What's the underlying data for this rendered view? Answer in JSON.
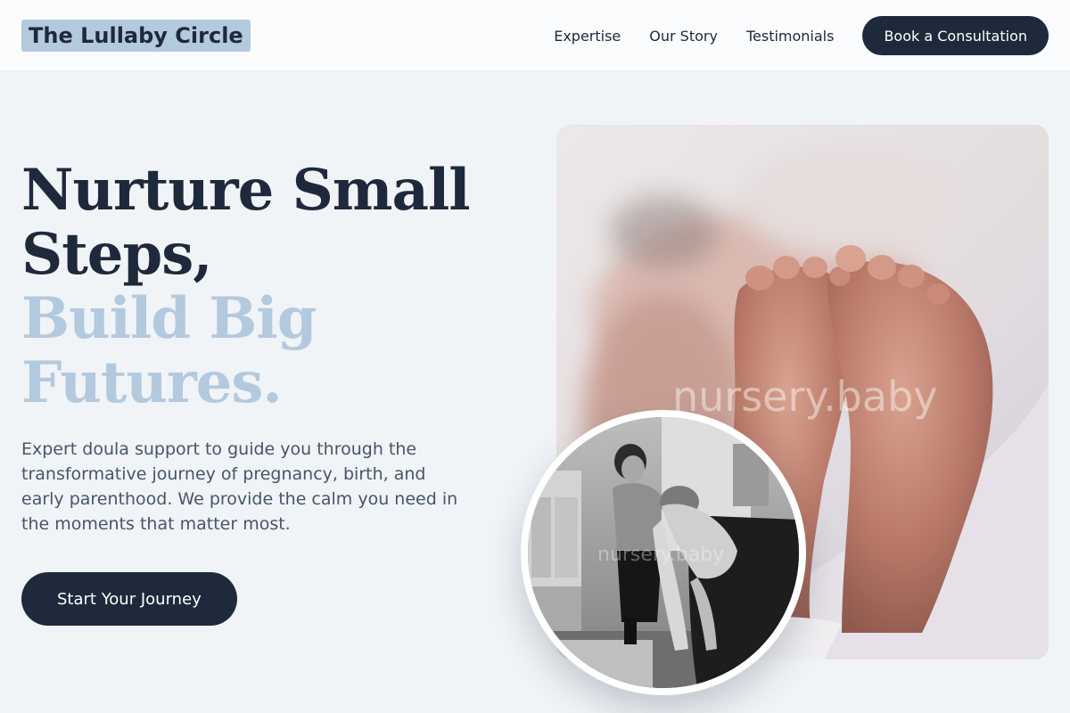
{
  "brand": {
    "name": "The Lullaby Circle"
  },
  "nav": {
    "links": [
      "Expertise",
      "Our Story",
      "Testimonials"
    ],
    "cta": "Book a Consultation"
  },
  "hero": {
    "title_dark": [
      "Nurture Small",
      "Steps,"
    ],
    "title_light": [
      "Build Big",
      "Futures."
    ],
    "description": "Expert doula support to guide you through the transformative journey of pregnancy, birth, and early parenthood. We provide the calm you need in the moments that matter most.",
    "cta": "Start Your Journey"
  },
  "images": {
    "main_watermark": "nursery.baby",
    "circle_watermark": "nursery.baby"
  },
  "colors": {
    "navy": "#1e293b",
    "accent_light": "#b3c9de",
    "background": "#f0f4f7",
    "body_text": "#475569"
  }
}
